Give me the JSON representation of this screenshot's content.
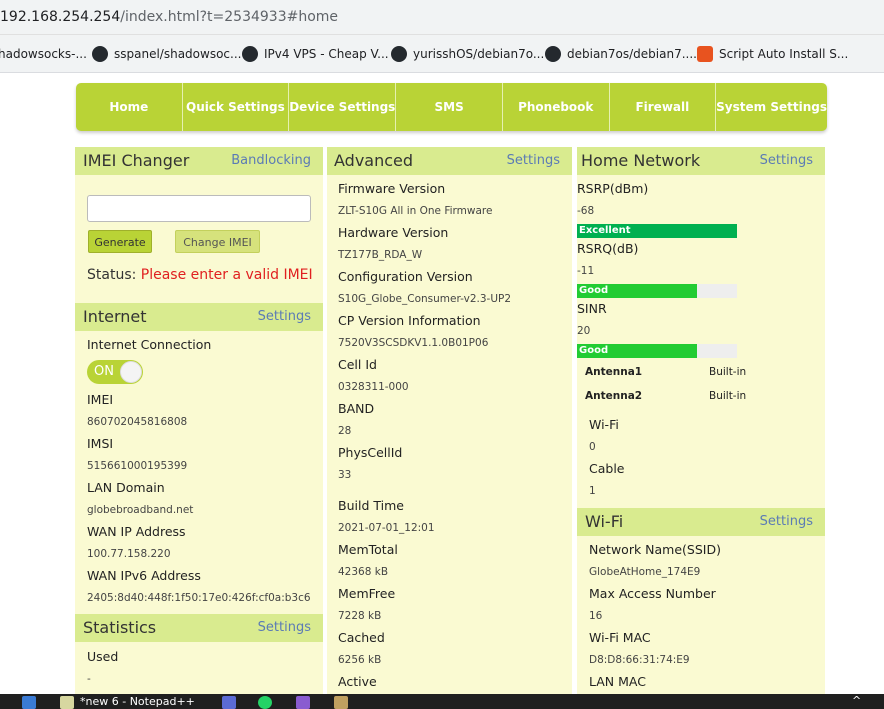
{
  "browser": {
    "url_host": "192.168.254.254",
    "url_path": "/index.html?t=2534933#home",
    "bookmarks": [
      {
        "label": "hadowsocks-..."
      },
      {
        "label": "sspanel/shadowsoc..."
      },
      {
        "label": "IPv4 VPS - Cheap V..."
      },
      {
        "label": "yurisshOS/debian7o..."
      },
      {
        "label": "debian7os/debian7...."
      },
      {
        "label": "Script Auto Install S..."
      }
    ]
  },
  "nav": {
    "items": [
      {
        "label": "Home"
      },
      {
        "label": "Quick Settings"
      },
      {
        "label": "Device Settings"
      },
      {
        "label": "SMS"
      },
      {
        "label": "Phonebook"
      },
      {
        "label": "Firewall"
      },
      {
        "label": "System Settings"
      }
    ]
  },
  "imei_changer": {
    "title": "IMEI Changer",
    "link": "Bandlocking",
    "input_value": "",
    "generate": "Generate",
    "change": "Change IMEI",
    "status_label": "Status:",
    "status_msg": "Please enter a valid IMEI"
  },
  "internet": {
    "title": "Internet",
    "settings": "Settings",
    "connection_label": "Internet Connection",
    "toggle": "ON",
    "fields": [
      {
        "label": "IMEI",
        "value": "860702045816808"
      },
      {
        "label": "IMSI",
        "value": "515661000195399"
      },
      {
        "label": "LAN Domain",
        "value": "globebroadband.net"
      },
      {
        "label": "WAN IP Address",
        "value": "100.77.158.220"
      },
      {
        "label": "WAN IPv6 Address",
        "value": "2405:8d40:448f:1f50:17e0:426f:cf0a:b3c6"
      }
    ]
  },
  "statistics": {
    "title": "Statistics",
    "settings": "Settings",
    "used_label": "Used",
    "used_value": "-"
  },
  "advanced": {
    "title": "Advanced",
    "settings": "Settings",
    "fields": [
      {
        "label": "Firmware Version",
        "value": "ZLT-S10G All in One Firmware"
      },
      {
        "label": "Hardware Version",
        "value": "TZ177B_RDA_W"
      },
      {
        "label": "Configuration Version",
        "value": "S10G_Globe_Consumer-v2.3-UP2"
      },
      {
        "label": "CP Version Information",
        "value": "7520V3SCSDKV1.1.0B01P06"
      },
      {
        "label": "Cell Id",
        "value": "0328311-000"
      },
      {
        "label": "BAND",
        "value": "28"
      },
      {
        "label": "PhysCellId",
        "value": "33"
      },
      {
        "label": "Build Time",
        "value": "2021-07-01_12:01"
      },
      {
        "label": "MemTotal",
        "value": "42368 kB"
      },
      {
        "label": "MemFree",
        "value": "7228 kB"
      },
      {
        "label": "Cached",
        "value": "6256 kB"
      },
      {
        "label": "Active",
        "value": ""
      }
    ]
  },
  "home_network": {
    "title": "Home Network",
    "settings": "Settings",
    "rsrp": {
      "label": "RSRP(dBm)",
      "value": "-68",
      "quality": "Excellent",
      "level": 1.0,
      "color": "#00b050"
    },
    "rsrq": {
      "label": "RSRQ(dB)",
      "value": "-11",
      "quality": "Good",
      "level": 0.75,
      "color": "#22cc33"
    },
    "sinr": {
      "label": "SINR",
      "value": "20",
      "quality": "Good",
      "level": 0.75,
      "color": "#22cc33"
    },
    "antennas": [
      {
        "label": "Antenna1",
        "value": "Built-in"
      },
      {
        "label": "Antenna2",
        "value": "Built-in"
      }
    ],
    "wifi_label": "Wi-Fi",
    "wifi_value": "0",
    "cable_label": "Cable",
    "cable_value": "1"
  },
  "wifi": {
    "title": "Wi-Fi",
    "settings": "Settings",
    "fields": [
      {
        "label": "Network Name(SSID)",
        "value": "GlobeAtHome_174E9"
      },
      {
        "label": "Max Access Number",
        "value": "16"
      },
      {
        "label": "Wi-Fi MAC",
        "value": "D8:D8:66:31:74:E9"
      },
      {
        "label": "LAN MAC",
        "value": ""
      }
    ]
  },
  "taskbar": {
    "active_window": "*new 6 - Notepad++"
  }
}
